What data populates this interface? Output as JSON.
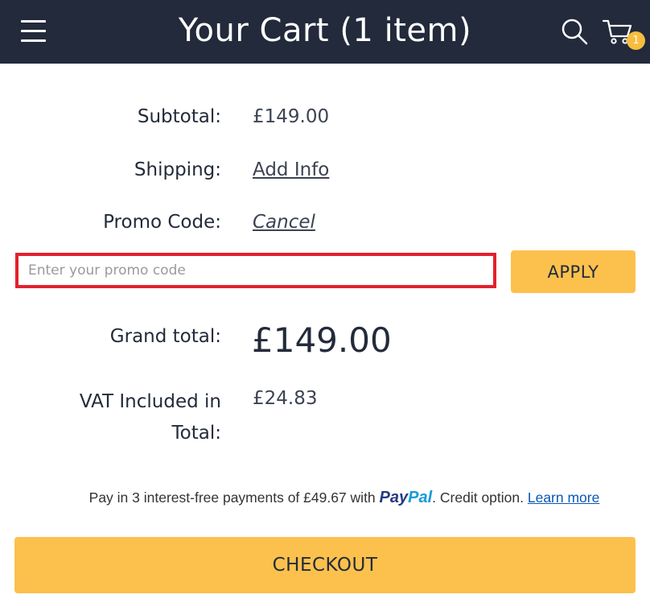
{
  "header": {
    "title": "Your Cart (1 item)",
    "cart_count": "1"
  },
  "summary": {
    "subtotal_label": "Subtotal:",
    "subtotal_value": "£149.00",
    "shipping_label": "Shipping:",
    "shipping_link": "Add Info",
    "promo_label": "Promo Code:",
    "promo_cancel": "Cancel",
    "promo_placeholder": "Enter your promo code",
    "apply_label": "APPLY",
    "grand_label": "Grand total:",
    "grand_value": "£149.00",
    "vat_label": "VAT Included in Total:",
    "vat_value": "£24.83"
  },
  "paypal": {
    "prefix": "Pay in 3 interest-free payments of £49.67 with",
    "logo_pay": "Pay",
    "logo_pal": "Pal",
    "suffix": ". Credit option.",
    "learn_more": "Learn more"
  },
  "checkout_label": "CHECKOUT",
  "colors": {
    "header_bg": "#222a3b",
    "accent": "#fcc14d",
    "highlight_border": "#e3212d"
  },
  "icons": [
    "hamburger-menu-icon",
    "search-icon",
    "cart-icon"
  ]
}
